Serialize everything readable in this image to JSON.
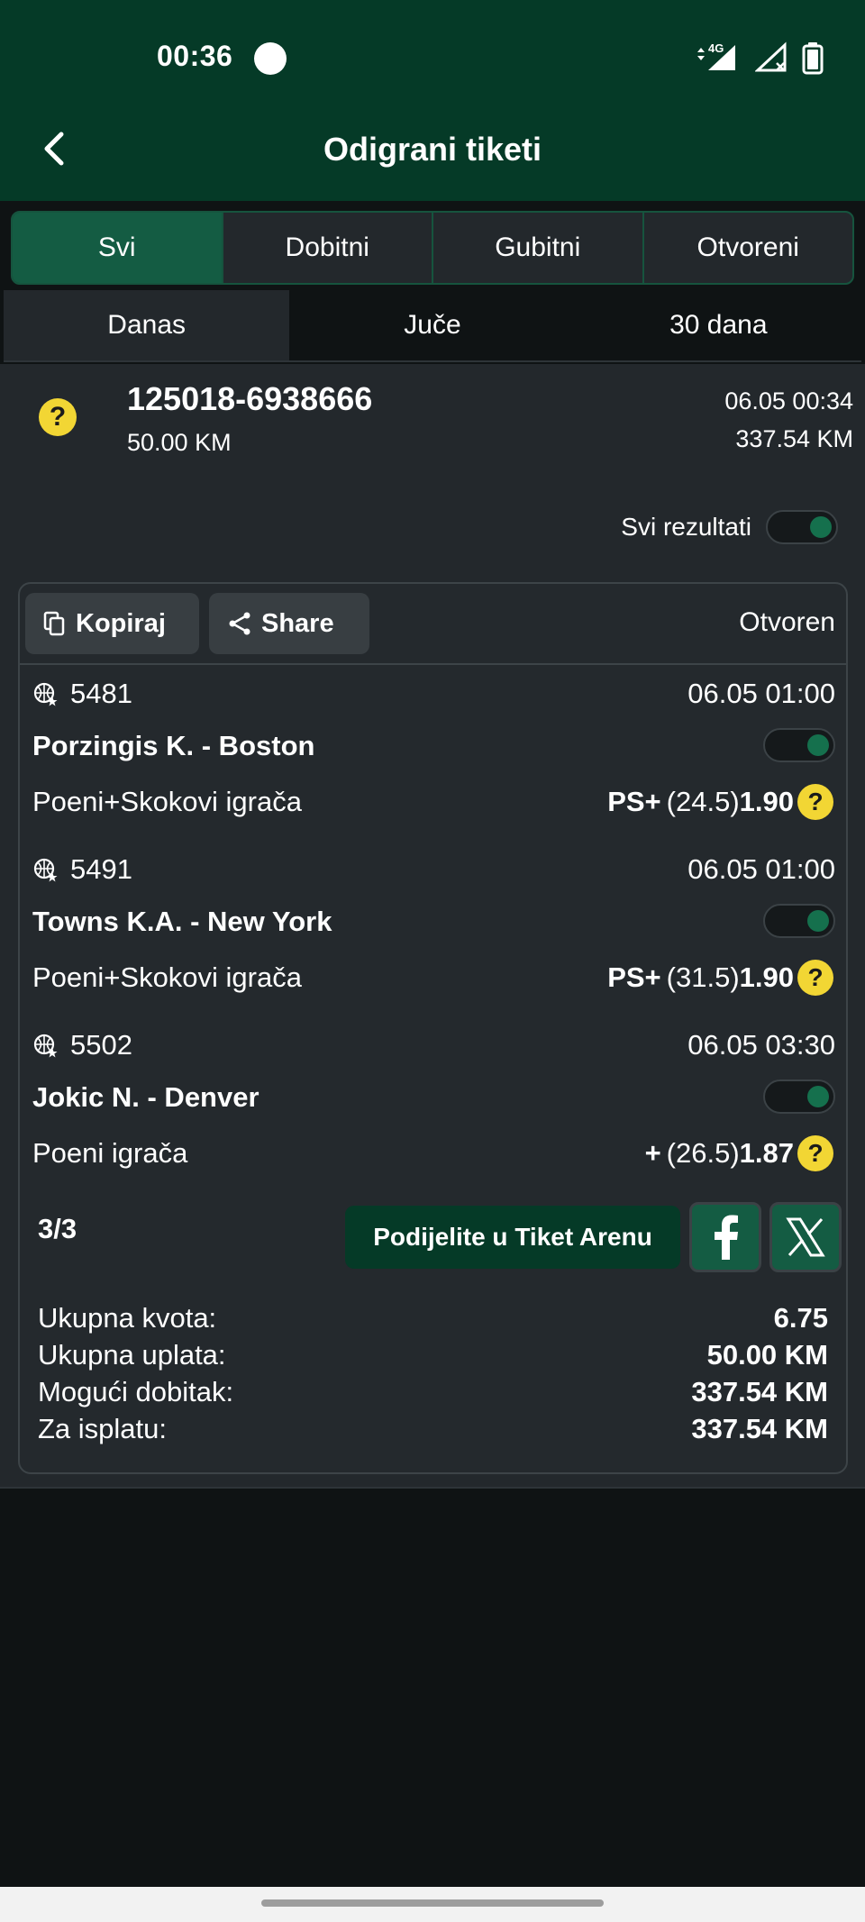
{
  "status_bar": {
    "time": "00:36",
    "network": "4G",
    "icons": [
      "record-dot-icon",
      "signal-4g-icon",
      "signal-no-service-icon",
      "battery-icon"
    ]
  },
  "header": {
    "title": "Odigrani tiketi",
    "back_icon": "chevron-left-icon"
  },
  "filter_tabs": [
    {
      "label": "Svi",
      "active": true
    },
    {
      "label": "Dobitni",
      "active": false
    },
    {
      "label": "Gubitni",
      "active": false
    },
    {
      "label": "Otvoreni",
      "active": false
    }
  ],
  "period_tabs": [
    {
      "label": "Danas",
      "active": true
    },
    {
      "label": "Juče",
      "active": false
    },
    {
      "label": "30 dana",
      "active": false
    }
  ],
  "ticket": {
    "id": "125018-6938666",
    "stake": "50.00 KM",
    "datetime": "06.05 00:34",
    "potential_win": "337.54 KM",
    "status_icon": "question-icon",
    "all_results_label": "Svi rezultati",
    "all_results_on": true,
    "copy_label": "Kopiraj",
    "share_label": "Share",
    "status": "Otvoren",
    "matches": [
      {
        "code": "5481",
        "time": "06.05 01:00",
        "name": "Porzingis K. - Boston",
        "market": "Poeni+Skokovi igrača",
        "pick": "PS+",
        "line": "(24.5)",
        "odd": "1.90",
        "sport_icon": "basketball-icon"
      },
      {
        "code": "5491",
        "time": "06.05 01:00",
        "name": "Towns K.A. - New York",
        "market": "Poeni+Skokovi igrača",
        "pick": "PS+",
        "line": "(31.5)",
        "odd": "1.90",
        "sport_icon": "basketball-icon"
      },
      {
        "code": "5502",
        "time": "06.05 03:30",
        "name": "Jokic N. - Denver",
        "market": "Poeni igrača",
        "pick": "+",
        "line": "(26.5)",
        "odd": "1.87",
        "sport_icon": "basketball-icon"
      }
    ],
    "count": "3/3",
    "arena_label": "Podijelite u Tiket Arenu",
    "summary": [
      {
        "label": "Ukupna kvota:",
        "value": "6.75"
      },
      {
        "label": "Ukupna uplata:",
        "value": "50.00 KM"
      },
      {
        "label": "Mogući dobitak:",
        "value": "337.54 KM"
      },
      {
        "label": "Za isplatu:",
        "value": "337.54 KM"
      }
    ]
  },
  "colors": {
    "brand_dark_green": "#053a27",
    "active_green": "#145c43",
    "panel": "#23282c",
    "background": "#0f1314",
    "help_yellow": "#f2d634"
  }
}
